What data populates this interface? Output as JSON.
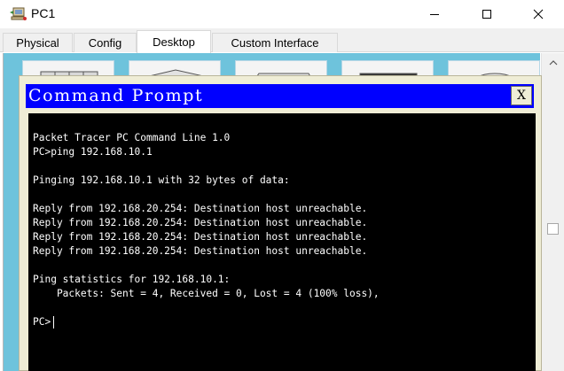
{
  "window": {
    "title": "PC1"
  },
  "tabs": [
    {
      "label": "Physical",
      "active": false
    },
    {
      "label": "Config",
      "active": false
    },
    {
      "label": "Desktop",
      "active": true
    },
    {
      "label": "Custom Interface",
      "active": false
    }
  ],
  "desktop": {
    "background_color": "#6ec3dc",
    "icons": [
      "ip-config-icon",
      "dial-up-icon",
      "terminal-icon",
      "command-prompt-icon",
      "web-browser-icon"
    ]
  },
  "command_prompt": {
    "title": "Command Prompt",
    "close_label": "X",
    "header_color": "#0000ff",
    "lines": [
      "Packet Tracer PC Command Line 1.0",
      "PC>ping 192.168.10.1",
      "",
      "Pinging 192.168.10.1 with 32 bytes of data:",
      "",
      "Reply from 192.168.20.254: Destination host unreachable.",
      "Reply from 192.168.20.254: Destination host unreachable.",
      "Reply from 192.168.20.254: Destination host unreachable.",
      "Reply from 192.168.20.254: Destination host unreachable.",
      "",
      "Ping statistics for 192.168.10.1:",
      "    Packets: Sent = 4, Received = 0, Lost = 4 (100% loss),",
      "",
      "PC>"
    ]
  }
}
